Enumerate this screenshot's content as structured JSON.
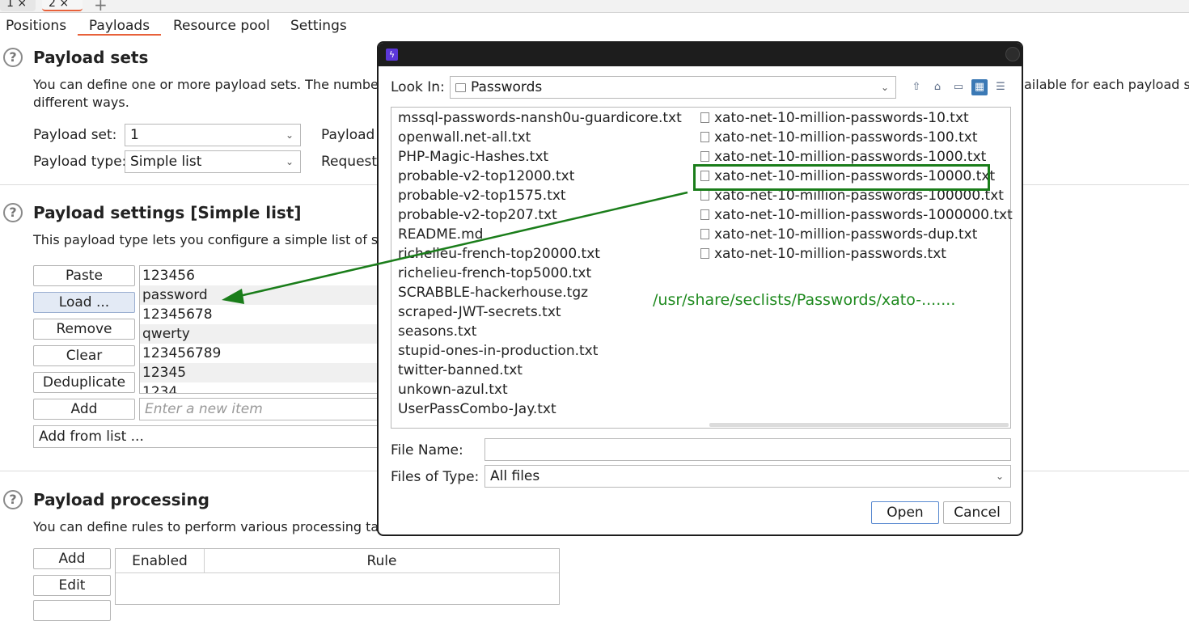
{
  "top_tabs": [
    {
      "label": "1 ×"
    },
    {
      "label": "2 ×"
    }
  ],
  "top_tab_add": "+",
  "sub_tabs": [
    "Positions",
    "Payloads",
    "Resource pool",
    "Settings"
  ],
  "payload_sets": {
    "title": "Payload sets",
    "desc_line1": "You can define one or more payload sets. The number",
    "desc_line1_tail": "ailable for each payload se",
    "desc_line2": "different ways.",
    "set_label": "Payload set:",
    "set_value": "1",
    "type_label": "Payload type:",
    "type_value": "Simple list",
    "count_label": "Payload",
    "request_label": "Request"
  },
  "payload_settings": {
    "title": "Payload settings [Simple list]",
    "desc": "This payload type lets you configure a simple list of str",
    "buttons": [
      "Paste",
      "Load ...",
      "Remove",
      "Clear",
      "Deduplicate",
      "Add"
    ],
    "items": [
      "123456",
      "password",
      "12345678",
      "qwerty",
      "123456789",
      "12345",
      "1234"
    ],
    "new_item_placeholder": "Enter a new item",
    "add_from_list": "Add from list ..."
  },
  "payload_processing": {
    "title": "Payload processing",
    "desc": "You can define rules to perform various processing tas",
    "buttons": [
      "Add",
      "Edit"
    ],
    "columns": [
      "Enabled",
      "Rule"
    ]
  },
  "dialog": {
    "look_in_label": "Look In:",
    "look_in_value": "Passwords",
    "toolbar_icons": [
      "up-folder-icon",
      "home-icon",
      "new-folder-icon",
      "grid-view-icon",
      "list-view-icon"
    ],
    "files_col1": [
      "mssql-passwords-nansh0u-guardicore.txt",
      "openwall.net-all.txt",
      "PHP-Magic-Hashes.txt",
      "probable-v2-top12000.txt",
      "probable-v2-top1575.txt",
      "probable-v2-top207.txt",
      "README.md",
      "richelieu-french-top20000.txt",
      "richelieu-french-top5000.txt",
      "SCRABBLE-hackerhouse.tgz",
      "scraped-JWT-secrets.txt",
      "seasons.txt",
      "stupid-ones-in-production.txt",
      "twitter-banned.txt",
      "unkown-azul.txt",
      "UserPassCombo-Jay.txt"
    ],
    "files_col2": [
      "xato-net-10-million-passwords-10.txt",
      "xato-net-10-million-passwords-100.txt",
      "xato-net-10-million-passwords-1000.txt",
      "xato-net-10-million-passwords-10000.txt",
      "xato-net-10-million-passwords-100000.txt",
      "xato-net-10-million-passwords-1000000.txt",
      "xato-net-10-million-passwords-dup.txt",
      "xato-net-10-million-passwords.txt"
    ],
    "annotation": "/usr/share/seclists/Passwords/xato-.......",
    "file_name_label": "File Name:",
    "file_name_value": "",
    "files_of_type_label": "Files of Type:",
    "files_of_type_value": "All files",
    "open_label": "Open",
    "cancel_label": "Cancel"
  },
  "colors": {
    "accent": "#e8613a",
    "annotation_green": "#1f8a1f",
    "highlight_box": "#1a7d1a",
    "selected_icon": "#3b79b5"
  }
}
